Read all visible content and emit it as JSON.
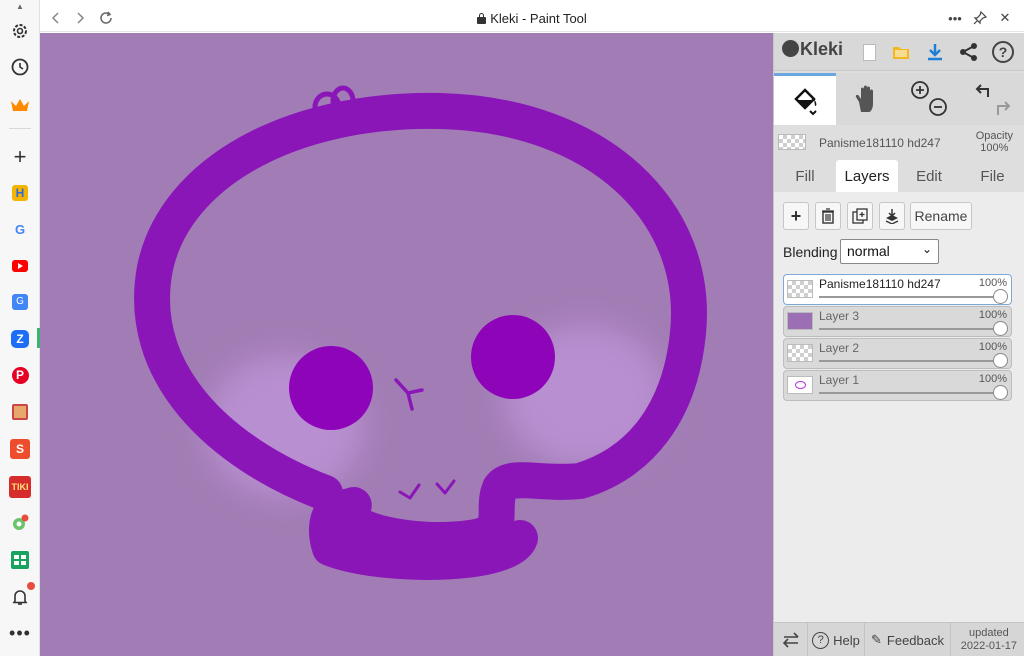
{
  "browser": {
    "window_title": "Kleki - Paint Tool",
    "nav": {
      "back_icon": "chevron-left-icon",
      "forward_icon": "chevron-right-icon",
      "reload_icon": "reload-icon"
    },
    "controls": [
      "more-icon",
      "pin-icon",
      "close-icon"
    ]
  },
  "sidebar": {
    "items": [
      "settings-icon",
      "history-icon",
      "crown-icon",
      "add-icon",
      "hometown-app-icon",
      "google-icon",
      "youtube-icon",
      "google-translate-icon",
      "zalo-icon",
      "pinterest-icon",
      "shop-icon",
      "shopee-icon",
      "tiki-icon",
      "lollipop-icon",
      "sheets-icon",
      "notification-bell-icon",
      "more-icon"
    ]
  },
  "app": {
    "logo": "Kleki",
    "header_icons": [
      "new-file-icon",
      "folder-icon",
      "download-icon",
      "share-icon",
      "help-icon"
    ],
    "tools": [
      "paint-bucket-icon",
      "hand-icon",
      "zoom-in-icon",
      "zoom-out-icon",
      "undo-icon",
      "redo-icon"
    ],
    "current_layer": {
      "name": "Panisme181110 hd247",
      "opacity_label": "Opacity",
      "opacity_value": "100%"
    },
    "tabs": [
      "Fill",
      "Layers",
      "Edit",
      "File"
    ],
    "active_tab": "Layers",
    "layer_buttons": {
      "add": "plus-icon",
      "delete": "trash-icon",
      "duplicate": "duplicate-icon",
      "merge": "merge-down-icon",
      "rename": "Rename"
    },
    "blending": {
      "label": "Blending",
      "value": "normal"
    },
    "layers": [
      {
        "name": "Panisme181110 hd247",
        "opacity": "100%",
        "active": true
      },
      {
        "name": "Layer 3",
        "opacity": "100%",
        "active": false
      },
      {
        "name": "Layer 2",
        "opacity": "100%",
        "active": false
      },
      {
        "name": "Layer 1",
        "opacity": "100%",
        "active": false
      }
    ],
    "footer": {
      "swap_icon": "swap-icon",
      "help": "Help",
      "feedback": "Feedback",
      "updated_label": "updated",
      "updated_date": "2022-01-17"
    }
  },
  "colors": {
    "canvas_bg": "#a27db5",
    "stroke": "#8a16b8",
    "eyes": "#8e04b8",
    "blush": "#b48fcc",
    "accent": "#6aa7e2"
  }
}
